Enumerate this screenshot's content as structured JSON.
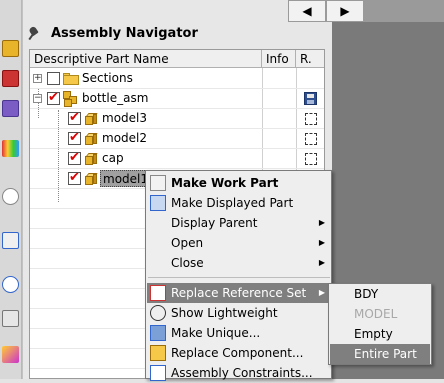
{
  "panel": {
    "title": "Assembly Navigator",
    "scroll_left": "◀",
    "scroll_right": "▶"
  },
  "table": {
    "columns": [
      "Descriptive Part Name",
      "Info",
      "R."
    ],
    "rows": [
      {
        "name": "Sections",
        "expander": "+"
      },
      {
        "name": "bottle_asm",
        "expander": "−"
      },
      {
        "name": "model3"
      },
      {
        "name": "model2"
      },
      {
        "name": "cap"
      },
      {
        "name": "model1"
      }
    ]
  },
  "context_menu": {
    "items": [
      {
        "label": "Make Work Part",
        "icon": "make-work-part-icon"
      },
      {
        "label": "Make Displayed Part",
        "icon": "make-displayed-part-icon"
      },
      {
        "label": "Display Parent",
        "arrow": "▶"
      },
      {
        "label": "Open",
        "arrow": "▶"
      },
      {
        "label": "Close",
        "arrow": "▶"
      },
      {
        "label": "Replace Reference Set",
        "arrow": "▶",
        "icon": "replace-reference-set-icon"
      },
      {
        "label": "Show Lightweight",
        "icon": "show-lightweight-icon"
      },
      {
        "label": "Make Unique...",
        "icon": "make-unique-icon"
      },
      {
        "label": "Replace Component...",
        "icon": "replace-component-icon"
      },
      {
        "label": "Assembly Constraints...",
        "icon": "assembly-constraints-icon"
      }
    ]
  },
  "submenu": {
    "items": [
      {
        "label": "BDY"
      },
      {
        "label": "MODEL"
      },
      {
        "label": "Empty"
      },
      {
        "label": "Entire Part"
      }
    ]
  },
  "colors": {
    "highlight": "#7f7f7f",
    "check": "#dd0000",
    "part": "#e8b52a"
  }
}
